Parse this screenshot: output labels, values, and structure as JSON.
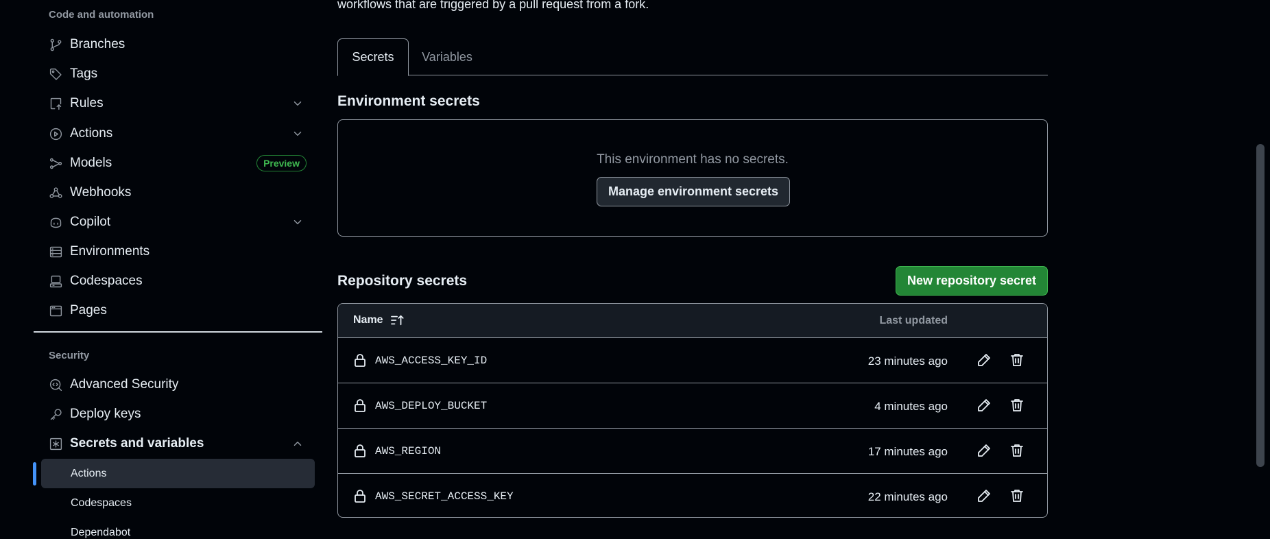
{
  "sidebar": {
    "code_heading": "Code and automation",
    "items": [
      {
        "label": "Branches",
        "icon": "branch-icon"
      },
      {
        "label": "Tags",
        "icon": "tag-icon"
      },
      {
        "label": "Rules",
        "icon": "rules-icon"
      },
      {
        "label": "Actions",
        "icon": "play-icon"
      },
      {
        "label": "Models",
        "icon": "models-icon",
        "badge": "Preview"
      },
      {
        "label": "Webhooks",
        "icon": "webhook-icon"
      },
      {
        "label": "Copilot",
        "icon": "copilot-icon"
      },
      {
        "label": "Environments",
        "icon": "server-icon"
      },
      {
        "label": "Codespaces",
        "icon": "codespaces-icon"
      },
      {
        "label": "Pages",
        "icon": "browser-icon"
      }
    ],
    "security_heading": "Security",
    "security_items": [
      {
        "label": "Advanced Security",
        "icon": "codescan-icon"
      },
      {
        "label": "Deploy keys",
        "icon": "key-icon"
      },
      {
        "label": "Secrets and variables",
        "icon": "asterisk-icon",
        "expanded": true
      }
    ],
    "sub_items": [
      {
        "label": "Actions",
        "active": true
      },
      {
        "label": "Codespaces"
      },
      {
        "label": "Dependabot"
      }
    ]
  },
  "main": {
    "intro_text": "workflows that are triggered by a pull request from a fork.",
    "tabs": [
      {
        "label": "Secrets",
        "selected": true
      },
      {
        "label": "Variables"
      }
    ],
    "env_heading": "Environment secrets",
    "env_empty": "This environment has no secrets.",
    "manage_button": "Manage environment secrets",
    "repo_heading": "Repository secrets",
    "new_button": "New repository secret",
    "table": {
      "col_name": "Name",
      "col_updated": "Last updated",
      "rows": [
        {
          "name": "AWS_ACCESS_KEY_ID",
          "updated": "23 minutes ago"
        },
        {
          "name": "AWS_DEPLOY_BUCKET",
          "updated": "4 minutes ago"
        },
        {
          "name": "AWS_REGION",
          "updated": "17 minutes ago"
        },
        {
          "name": "AWS_SECRET_ACCESS_KEY",
          "updated": "22 minutes ago"
        }
      ]
    }
  },
  "colors": {
    "background": "#010409",
    "accent_green": "#238636",
    "active_marker": "#4493f8"
  }
}
